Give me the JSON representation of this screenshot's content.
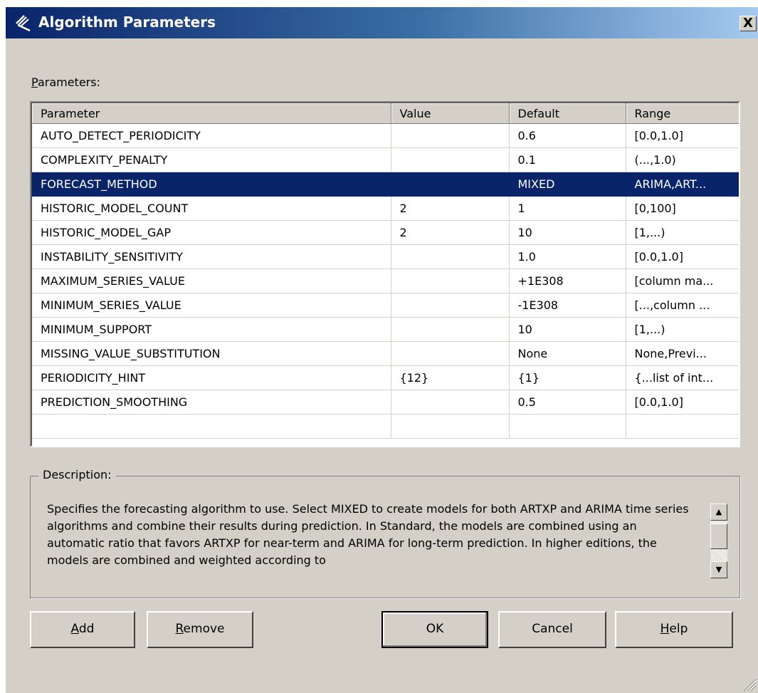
{
  "window": {
    "title": "Algorithm Parameters",
    "close_label": "X"
  },
  "parameters_section": {
    "label_accel": "P",
    "label_rest": "arameters:"
  },
  "table": {
    "columns": [
      "Parameter",
      "Value",
      "Default",
      "Range"
    ],
    "rows": [
      {
        "parameter": "AUTO_DETECT_PERIODICITY",
        "value": "",
        "default": "0.6",
        "range": "[0.0,1.0]"
      },
      {
        "parameter": "COMPLEXITY_PENALTY",
        "value": "",
        "default": "0.1",
        "range": "(...,1.0)"
      },
      {
        "parameter": "FORECAST_METHOD",
        "value": "",
        "default": "MIXED",
        "range": "ARIMA,ART..."
      },
      {
        "parameter": "HISTORIC_MODEL_COUNT",
        "value": "2",
        "default": "1",
        "range": "[0,100]"
      },
      {
        "parameter": "HISTORIC_MODEL_GAP",
        "value": "2",
        "default": "10",
        "range": "[1,...)"
      },
      {
        "parameter": "INSTABILITY_SENSITIVITY",
        "value": "",
        "default": "1.0",
        "range": "[0.0,1.0]"
      },
      {
        "parameter": "MAXIMUM_SERIES_VALUE",
        "value": "",
        "default": "+1E308",
        "range": "[column ma..."
      },
      {
        "parameter": "MINIMUM_SERIES_VALUE",
        "value": "",
        "default": "-1E308",
        "range": "[...,column ..."
      },
      {
        "parameter": "MINIMUM_SUPPORT",
        "value": "",
        "default": "10",
        "range": "[1,...)"
      },
      {
        "parameter": "MISSING_VALUE_SUBSTITUTION",
        "value": "",
        "default": "None",
        "range": "None,Previ..."
      },
      {
        "parameter": "PERIODICITY_HINT",
        "value": "{12}",
        "default": "{1}",
        "range": "{...list of int..."
      },
      {
        "parameter": "PREDICTION_SMOOTHING",
        "value": "",
        "default": "0.5",
        "range": "[0.0,1.0]"
      }
    ],
    "selected_parameter": "FORECAST_METHOD"
  },
  "description": {
    "legend": "Description:",
    "text": "Specifies the forecasting algorithm to use. Select MIXED to create models for both ARTXP and ARIMA time series algorithms and combine their results during prediction. In Standard, the models are combined using an automatic ratio that favors ARTXP for near-term and ARIMA for long-term prediction. In higher editions, the models are combined and weighted according to"
  },
  "buttons": {
    "add": {
      "accel": "A",
      "rest": "dd"
    },
    "remove": {
      "accel": "R",
      "rest": "emove"
    },
    "ok": "OK",
    "cancel": "Cancel",
    "help": {
      "accel": "H",
      "rest": "elp"
    }
  },
  "colors": {
    "selection": "#0a246a",
    "dialog_face": "#d4d0c8"
  }
}
